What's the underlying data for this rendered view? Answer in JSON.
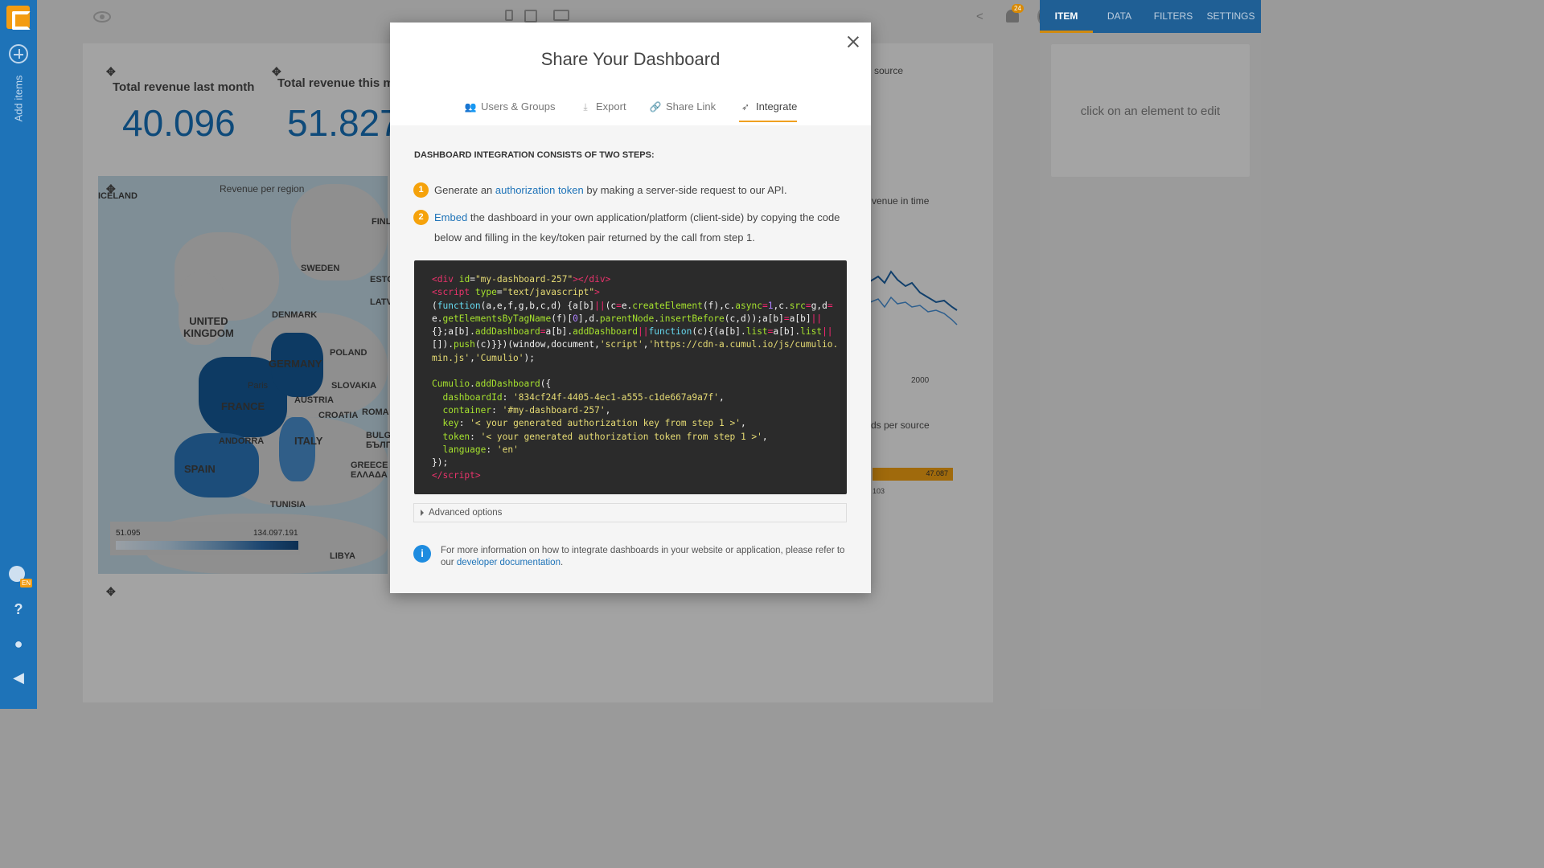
{
  "rail": {
    "add_items": "Add items",
    "lang": "EN"
  },
  "topbar": {
    "notifications": "24"
  },
  "right_panel": {
    "tabs": [
      "ITEM",
      "DATA",
      "FILTERS",
      "SETTINGS"
    ],
    "placeholder": "click on an element to edit"
  },
  "canvas": {
    "kpi1_label": "Total revenue last month",
    "kpi1_value": "40.096",
    "kpi2_label": "Total revenue this mo",
    "kpi2_value": "51.827",
    "map_title": "Revenue per region",
    "legend_min": "51.095",
    "legend_max": "134.097.191",
    "bg_source": "source",
    "bg_revenue_time": "venue in time",
    "bg_axis_2000": "2000",
    "bg_per_source": "ds per source",
    "bg_bar_value": "47.087",
    "bg_bar_small": "103",
    "map_labels": {
      "iceland": "ICELAND",
      "finland": "FINL",
      "sweden": "SWEDEN",
      "esto": "ESTO",
      "latv": "LATV",
      "uk": "UNITED\nKINGDOM",
      "denmark": "DENMARK",
      "poland": "POLAND",
      "germany": "GERMANY",
      "paris": "Paris",
      "france": "FRANCE",
      "austria": "AUSTRIA",
      "slovakia": "SLOVAKIA",
      "croatia": "CROATIA",
      "andorra": "ANDORRA",
      "italy": "ITALY",
      "spain": "SPAIN",
      "greece": "GREECE\nΕΛΛΑΔΑ",
      "tunisia": "TUNISIA",
      "libya": "LIBYA",
      "roma": "ROMA",
      "bulg": "BULG\nБЪЛГ"
    }
  },
  "modal": {
    "title": "Share Your Dashboard",
    "tabs": [
      "Users & Groups",
      "Export",
      "Share Link",
      "Integrate"
    ],
    "active_tab": "Integrate",
    "heading": "DASHBOARD INTEGRATION CONSISTS OF TWO STEPS:",
    "step1": {
      "num": "1",
      "pre": "Generate an ",
      "link": "authorization token",
      "post": " by making a server-side request to our API."
    },
    "step2": {
      "num": "2",
      "link": "Embed",
      "post": " the dashboard in your own application/platform (client-side) by copying the code below and filling in the key/token pair returned by the call from step 1."
    },
    "advanced": "Advanced options",
    "info_pre": "For more information on how to integrate dashboards in your website or application, please refer to our ",
    "info_link": "developer documentation",
    "info_post": ".",
    "code": {
      "dashboard_id": "'834cf24f-4405-4ec1-a555-c1de667a9a7f'",
      "container": "'#my-dashboard-257'",
      "key": "'< your generated authorization key from step 1 >'",
      "token": "'< your generated authorization token from step 1 >'",
      "language": "'en'",
      "div_id": "\"my-dashboard-257\"",
      "cdn": "'https://cdn-a.cumul.io/js/cumulio.",
      "cdn2": "min.js'",
      "cumulio_str": "'Cumulio'"
    }
  }
}
